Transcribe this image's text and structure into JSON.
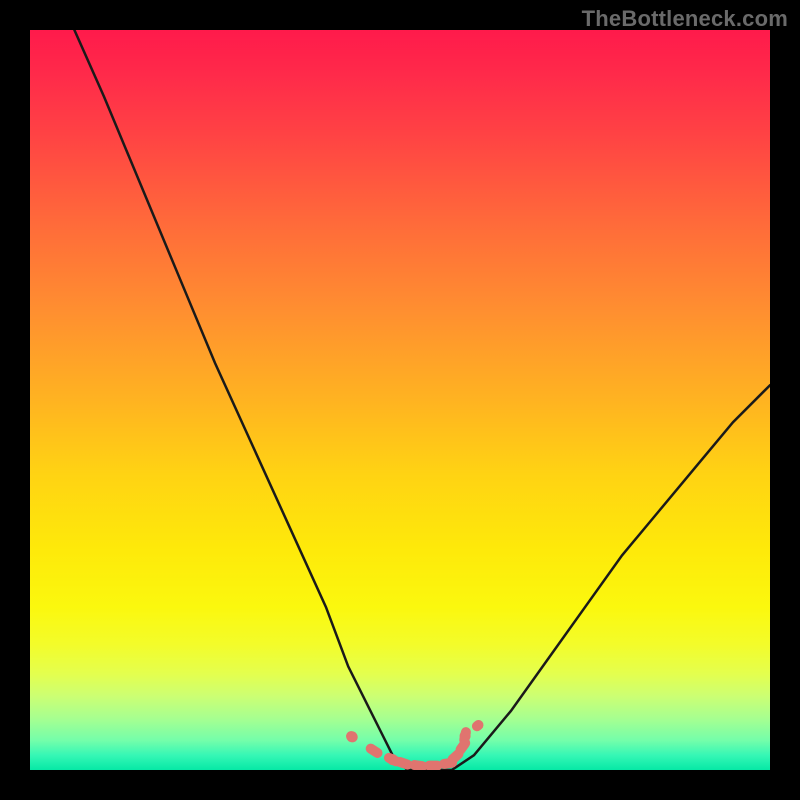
{
  "watermark": "TheBottleneck.com",
  "colors": {
    "gradient_top": "#ff1a4b",
    "gradient_mid": "#fee90a",
    "gradient_bottom": "#06e9a6",
    "curve_stroke": "#1a1a1a",
    "marker_fill": "#e0746f",
    "frame_bg": "#000000"
  },
  "chart_data": {
    "type": "line",
    "title": "",
    "xlabel": "",
    "ylabel": "",
    "xlim": [
      0,
      100
    ],
    "ylim": [
      0,
      100
    ],
    "grid": false,
    "legend": false,
    "annotations": [],
    "series": [
      {
        "name": "bottleneck-curve",
        "x": [
          6,
          10,
          15,
          20,
          25,
          30,
          35,
          40,
          43,
          46,
          49,
          51,
          54,
          57,
          60,
          65,
          70,
          75,
          80,
          85,
          90,
          95,
          100
        ],
        "values": [
          100,
          91,
          79,
          67,
          55,
          44,
          33,
          22,
          14,
          8,
          2,
          0,
          0,
          0,
          2,
          8,
          15,
          22,
          29,
          35,
          41,
          47,
          52
        ]
      },
      {
        "name": "bottom-markers",
        "x": [
          43.5,
          46.5,
          49.0,
          50.5,
          52.5,
          54.5,
          56.5,
          57.5,
          58.5,
          58.8,
          60.5
        ],
        "values": [
          4.5,
          2.6,
          1.4,
          0.9,
          0.6,
          0.6,
          0.9,
          1.8,
          3.2,
          4.6,
          6.0
        ]
      }
    ]
  }
}
